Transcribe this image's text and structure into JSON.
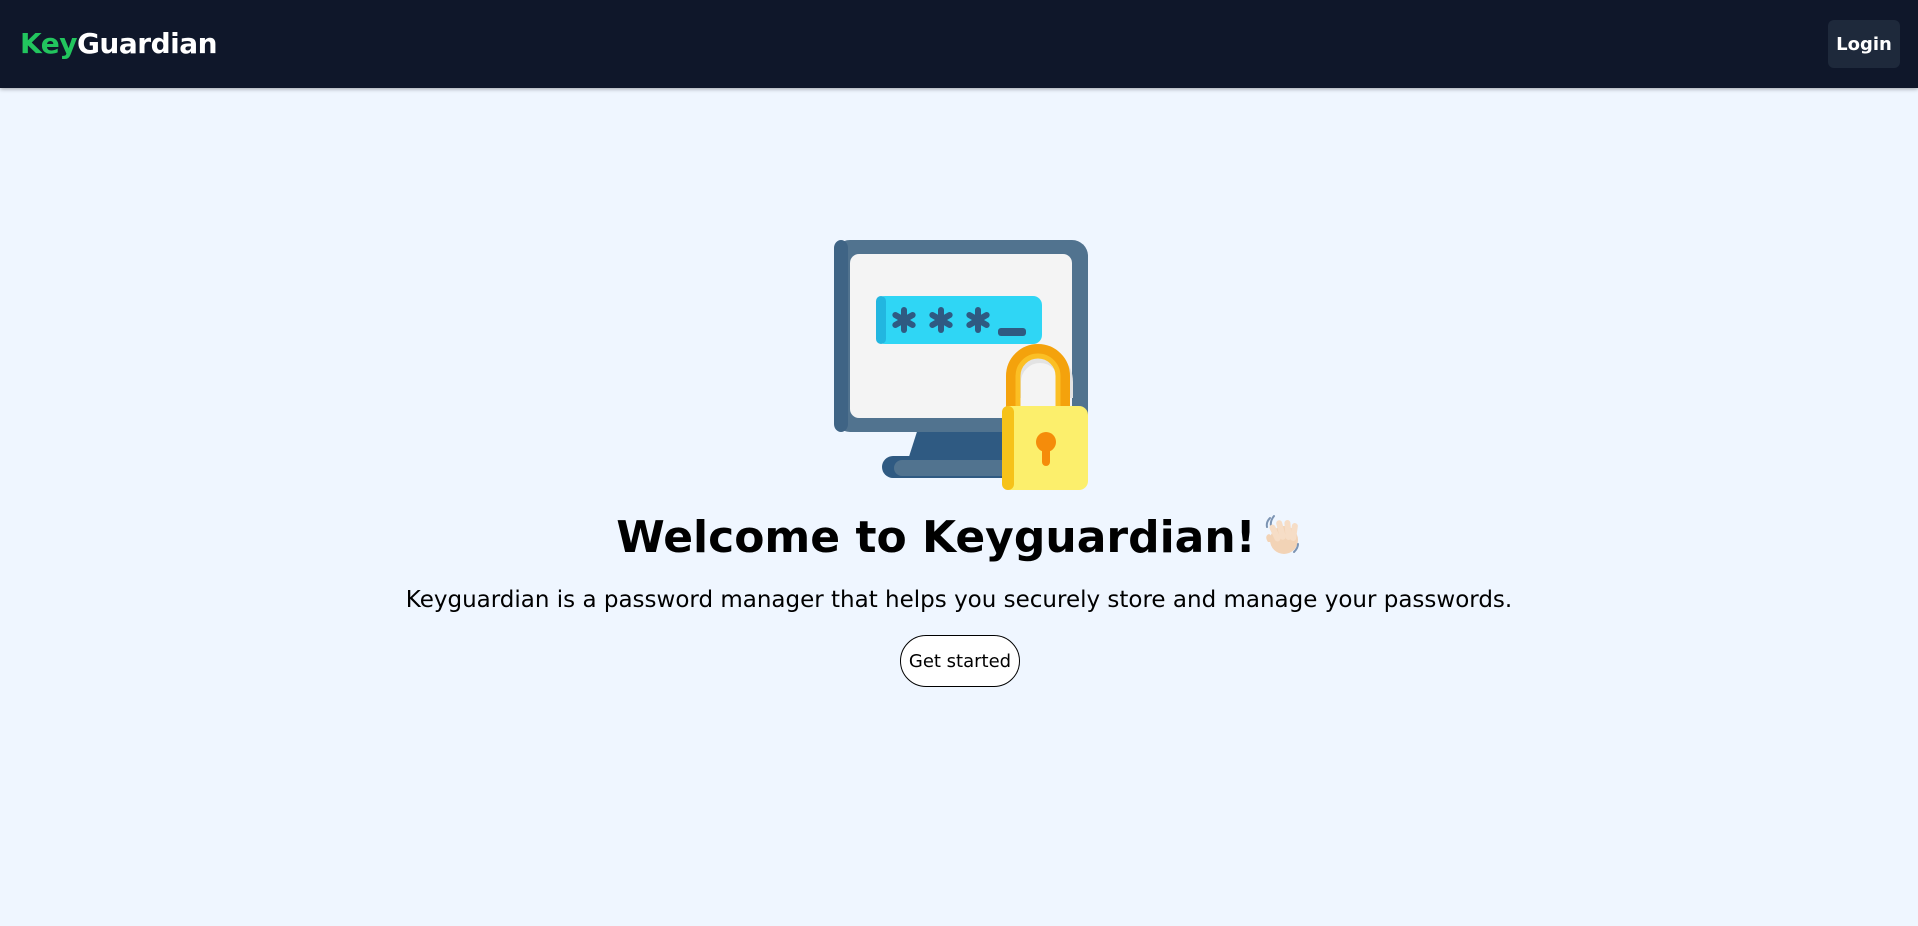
{
  "header": {
    "brand_part1": "Key",
    "brand_part2": "Guardian",
    "login_label": "Login"
  },
  "hero": {
    "illustration_icon": "computer-password-lock-icon",
    "password_mask": "***_",
    "title": "Welcome to Keyguardian!",
    "title_icon": "waving-hand-icon",
    "subtitle": "Keyguardian is a password manager that helps you securely store and manage your passwords.",
    "cta_label": "Get started"
  },
  "colors": {
    "navbar_bg": "#0f172a",
    "brand_accent": "#22c55e",
    "page_bg": "#eff6ff",
    "login_bg": "#1e293b"
  }
}
